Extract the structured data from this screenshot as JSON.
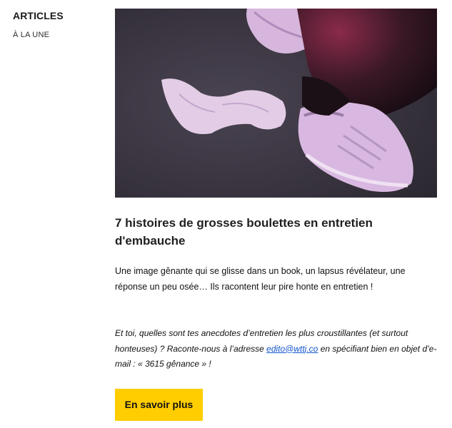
{
  "sidebar": {
    "title": "ARTICLES",
    "link": "À LA UNE"
  },
  "article": {
    "image_alt": "Pieds en baskets roses avec une chaussette au sol",
    "headline": "7 histoires de grosses boulettes en entretien d'embauche",
    "intro": "Une image gênante qui se glisse dans un book, un lapsus révélateur, une réponse un peu osée… Ils racontent leur pire honte en entretien !",
    "cta_before": "Et toi, quelles sont tes anecdotes d’entretien les plus croustillantes (et surtout honteuses) ? Raconte-nous à l’adresse ",
    "cta_email": "edito@wttj.co",
    "cta_after": " en spécifiant bien en objet d’e-mail : « 3615 gênance » !",
    "button_label": "En savoir plus"
  },
  "colors": {
    "button_bg": "#ffcd00",
    "link": "#1155cc",
    "hero_floor": "#3a3541",
    "sneaker": "#d8b8e0"
  }
}
